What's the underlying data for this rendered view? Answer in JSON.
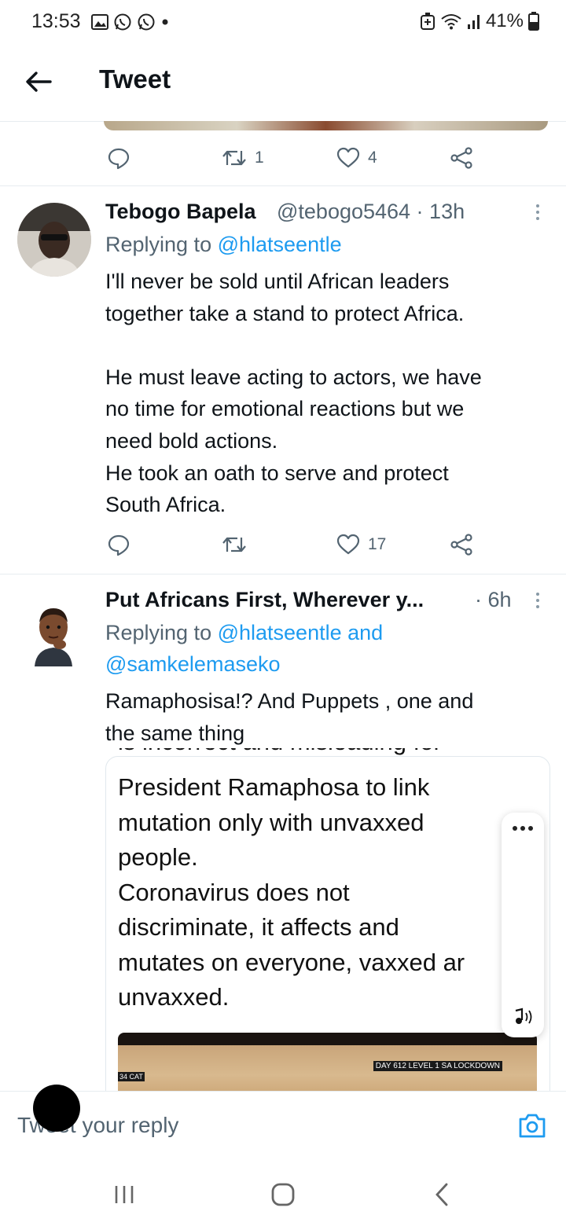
{
  "status_bar": {
    "time": "13:53",
    "battery": "41%",
    "icons": [
      "gallery-icon",
      "whatsapp-icon",
      "whatsapp-icon",
      "dot-icon",
      "alarm-icon",
      "wifi-icon",
      "signal-icon",
      "battery-icon"
    ]
  },
  "header": {
    "title": "Tweet"
  },
  "tweet0": {
    "retweets": "1",
    "likes": "4"
  },
  "tweet1": {
    "name": "Tebogo Bapela",
    "handle": "@tebogo5464 · 13h",
    "replying_prefix": "Replying to ",
    "replying_to": "@hlatseentle",
    "lines": [
      "I'll never be sold until African leaders",
      "together take a stand to protect Africa.",
      "",
      "He must leave acting to actors, we have",
      "no time for emotional reactions but we",
      "need bold actions.",
      "He took an oath to serve and protect",
      "South Africa."
    ],
    "likes": "17"
  },
  "tweet2": {
    "name": "Put Africans First, Wherever y...",
    "time": "· 6h",
    "replying_prefix": "Replying to ",
    "replying_to_1": "@hlatseentle and",
    "replying_to_2": "@samkelemaseko",
    "lines": [
      "Ramaphosisa!? And Puppets , one and",
      "the same thing"
    ],
    "embed_cut": "is incorrect and misleading for",
    "embed_lines": [
      "President Ramaphosa to link",
      "mutation only with unvaxxed",
      "people.",
      "Coronavirus does not",
      "discriminate, it affects and",
      "mutates on everyone, vaxxed ar",
      "unvaxxed."
    ],
    "photo_label_left": "34 CAT",
    "photo_label_right": "DAY 612 LEVEL 1 SA LOCKDOWN"
  },
  "reply_bar": {
    "placeholder": "Tweet your reply"
  },
  "colors": {
    "accent": "#1d9bf0",
    "muted": "#536471",
    "text": "#0f1419"
  }
}
